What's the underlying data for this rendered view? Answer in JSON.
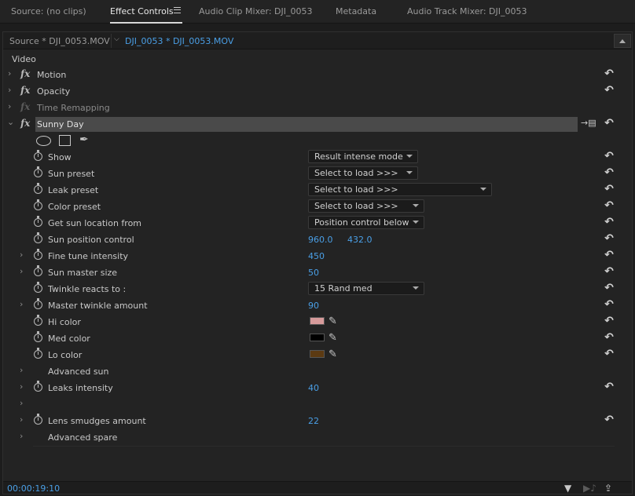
{
  "tabs": [
    {
      "label": "Source: (no clips)"
    },
    {
      "label": "Effect Controls"
    },
    {
      "label": "Audio Clip Mixer: DJI_0053"
    },
    {
      "label": "Metadata"
    },
    {
      "label": "Audio Track Mixer: DJI_0053"
    }
  ],
  "sequence": {
    "source_label": "Source * DJI_0053.MOV",
    "clip_label": "DJI_0053 * DJI_0053.MOV"
  },
  "section_video": "Video",
  "fx": "fx",
  "effects": [
    {
      "label": "Motion"
    },
    {
      "label": "Opacity"
    },
    {
      "label": "Time Remapping"
    },
    {
      "label": "Sunny Day"
    }
  ],
  "properties": [
    {
      "label": "Show",
      "dropdown": "Result intense mode"
    },
    {
      "label": "Sun preset",
      "dropdown": "Select to load >>>"
    },
    {
      "label": "Leak preset",
      "dropdown": "Select to load >>>"
    },
    {
      "label": "Color preset",
      "dropdown": "Select to load >>>"
    },
    {
      "label": "Get sun location from",
      "dropdown": "Position control below"
    },
    {
      "label": "Sun position control",
      "value": "960.0",
      "value2": "432.0"
    },
    {
      "label": "Fine tune intensity",
      "value": "450"
    },
    {
      "label": "Sun master size",
      "value": "50"
    },
    {
      "label": "Twinkle reacts to  :",
      "dropdown": "15 Rand med"
    },
    {
      "label": "Master twinkle amount",
      "value": "90"
    },
    {
      "label": "Hi color",
      "color": "#d69a9a"
    },
    {
      "label": "Med color",
      "color": "#000000"
    },
    {
      "label": "Lo color",
      "color": "#5c3a12"
    },
    {
      "label": "Advanced sun"
    },
    {
      "label": "Leaks intensity",
      "value": "40"
    },
    {
      "label": ""
    },
    {
      "label": "Lens smudges amount",
      "value": "22"
    },
    {
      "label": "Advanced spare"
    }
  ],
  "timecode": "00:00:19:10",
  "colors": {
    "accent": "#4a9fe6",
    "panel_bg": "#232323",
    "effect_header_bg": "#4a4a4a"
  },
  "icons": {
    "reset": "reset-icon",
    "stopwatch": "stopwatch-icon",
    "eyedropper": "eyedropper-icon",
    "filter": "filter-icon"
  }
}
